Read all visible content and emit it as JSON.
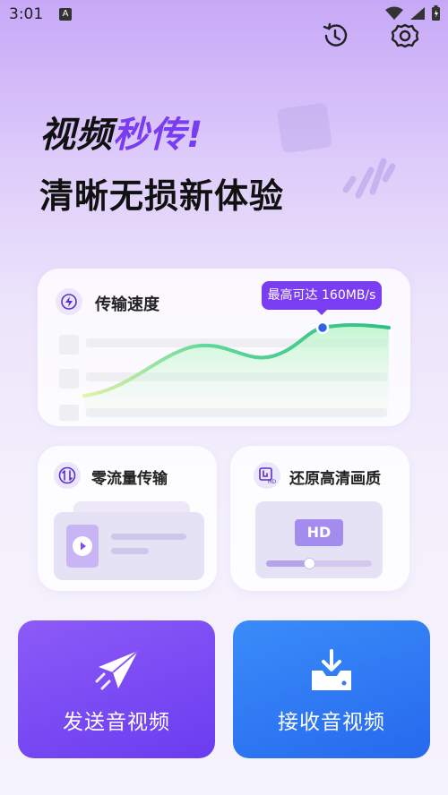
{
  "status_bar": {
    "time": "3:01",
    "notification_icon": "A"
  },
  "header": {
    "title_line1_part1": "视频",
    "title_line1_part2": "秒传!",
    "title_line2": "清晰无损新体验"
  },
  "speed_card": {
    "title": "传输速度",
    "tooltip": "最高可达 160MB/s"
  },
  "feature_cards": [
    {
      "title": "零流量传输",
      "icon": "no-traffic-icon"
    },
    {
      "title": "还原高清画质",
      "icon": "hd-quality-icon",
      "badge": "HD"
    }
  ],
  "actions": {
    "send_label": "发送音视频",
    "receive_label": "接收音视频"
  },
  "colors": {
    "accent": "#7a3cf0",
    "send": "#7a48f4",
    "receive": "#2f7bf3"
  }
}
